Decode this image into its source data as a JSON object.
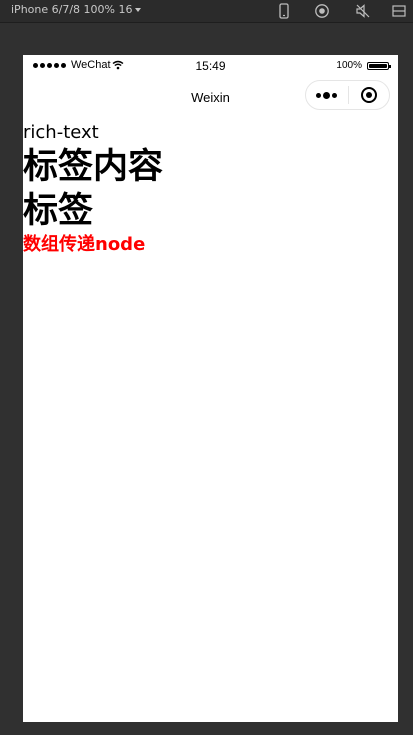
{
  "devtools": {
    "device_label": "iPhone 6/7/8 100% 16",
    "icons": [
      "phone-icon",
      "record-icon",
      "mute-icon",
      "detach-icon"
    ]
  },
  "status_bar": {
    "carrier": "WeChat",
    "time": "15:49",
    "battery_percent": "100%",
    "battery_level": 1.0
  },
  "nav_bar": {
    "title": "Weixin",
    "capsule_icons": [
      "more-icon",
      "close-target-icon"
    ]
  },
  "content": {
    "label": "rich-text",
    "heading_1": "标签内容",
    "heading_2": "标签",
    "array_node_text": "数组传递node",
    "array_node_color": "#ff0000"
  }
}
